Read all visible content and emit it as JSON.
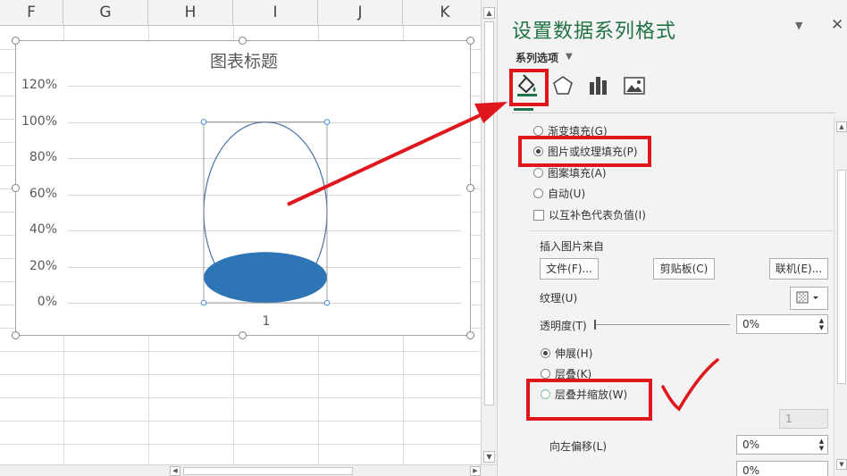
{
  "spreadsheet": {
    "columns": [
      {
        "label": "F"
      },
      {
        "label": "G"
      },
      {
        "label": "H"
      },
      {
        "label": "I"
      },
      {
        "label": "J"
      },
      {
        "label": "K"
      }
    ]
  },
  "chart": {
    "title": "图表标题",
    "y_ticks": [
      "120%",
      "100%",
      "80%",
      "60%",
      "40%",
      "20%",
      "0%"
    ],
    "x_label": "1"
  },
  "chart_data": {
    "type": "bar",
    "title": "图表标题",
    "categories": [
      "1"
    ],
    "ylim": [
      0,
      1.2
    ],
    "y_ticks": [
      0,
      0.2,
      0.4,
      0.6,
      0.8,
      1.0,
      1.2
    ],
    "y_tick_format": "percent",
    "grid": true,
    "series": [
      {
        "values": [
          1.0
        ],
        "fill": "none",
        "stroke": "#4a6fa5"
      },
      {
        "values": [
          0.14
        ],
        "fill": "#2e75b6"
      }
    ]
  },
  "pane": {
    "title": "设置数据系列格式",
    "series_options": "系列选项",
    "fill_options": [
      {
        "label": "渐变填充(G)",
        "selected": false
      },
      {
        "label": "图片或纹理填充(P)",
        "selected": true
      },
      {
        "label": "图案填充(A)",
        "selected": false
      },
      {
        "label": "自动(U)",
        "selected": false
      }
    ],
    "invert_if_negative": "以互补色代表负值(I)",
    "insert_from": "插入图片来自",
    "file_button": "文件(F)...",
    "clipboard_button": "剪贴板(C)",
    "online_button": "联机(E)...",
    "texture_label": "纹理(U)",
    "transparency_label": "透明度(T)",
    "transparency_value": "0%",
    "stretch_options": [
      {
        "label": "伸展(H)",
        "selected": true
      },
      {
        "label": "层叠(K)",
        "selected": false
      },
      {
        "label": "层叠并缩放(W)",
        "selected": false
      }
    ],
    "scale_value": "1",
    "offset_left_label": "向左偏移(L)",
    "offset_left_value": "0%",
    "offset_right_value": "0%"
  },
  "colors": {
    "accent": "#217346",
    "series_fill": "#2e75b6",
    "annotation": "#e0161d"
  }
}
